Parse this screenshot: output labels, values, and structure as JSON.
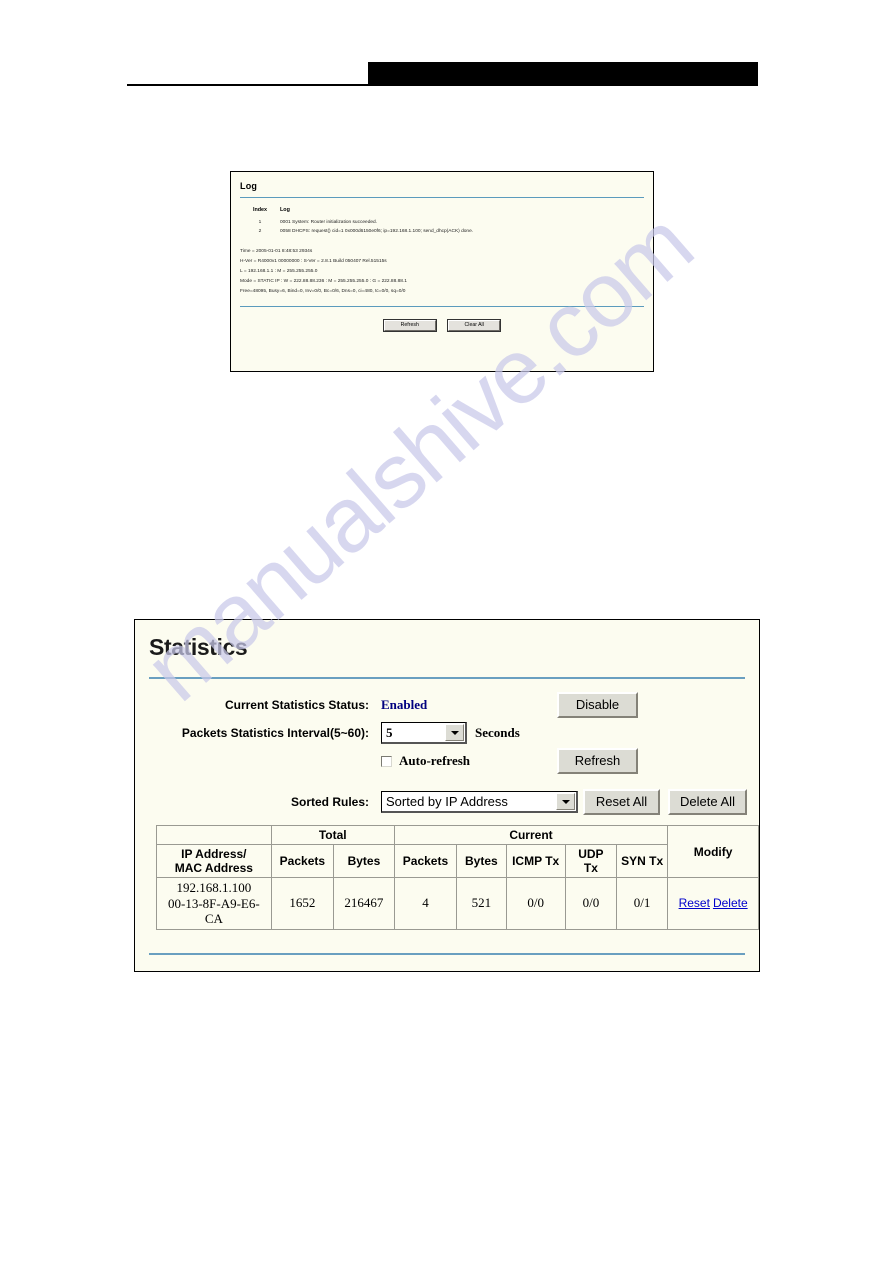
{
  "page": {
    "watermark": "manualshive.com",
    "header_redaction": ""
  },
  "log_panel": {
    "title": "Log",
    "columns": {
      "index": "Index",
      "log": "Log"
    },
    "entries": [
      {
        "index": "1",
        "message": "0001 System: Router initialization succeeded."
      },
      {
        "index": "2",
        "message": "0058 DHCPS: request() cid=1 0x000d6150e0f6; ip=192.168.1.100; send_dhcp(ACK) done."
      }
    ],
    "details": [
      "Time = 2005-01-01 8:48:53 2934s",
      "H-Ver = R4000v1 00000000 : S-Ver = 2.8.1 Build 050407 Rel.51515s",
      "L = 192.168.1.1 : M = 255.255.255.0",
      "Mode = STATIC IP : W = 222.88.88.236 : M = 255.255.255.0 : G = 222.88.88.1",
      "Free=48095, Busy=6, Bind=0, Inv=0/0, Bc=0/6, Dns=0, ci=480, tc=0/0, sq=0/0"
    ],
    "buttons": {
      "refresh": "Refresh",
      "clear_all": "Clear All"
    }
  },
  "statistics_panel": {
    "title": "Statistics",
    "fields": {
      "status_label": "Current Statistics Status:",
      "status_value": "Enabled",
      "status_button": "Disable",
      "interval_label": "Packets Statistics Interval(5~60):",
      "interval_value": "5",
      "interval_unit": "Seconds",
      "autorefresh_label": "Auto-refresh",
      "autorefresh_checked": false,
      "refresh_button": "Refresh",
      "sorted_label": "Sorted Rules:",
      "sorted_value": "Sorted by IP Address",
      "reset_all_button": "Reset All",
      "delete_all_button": "Delete All"
    },
    "table": {
      "group_headers": {
        "blank": "",
        "total": "Total",
        "current": "Current",
        "modify": "Modify"
      },
      "columns": [
        "IP Address/",
        "MAC Address",
        "Packets",
        "Bytes",
        "Packets",
        "Bytes",
        "ICMP Tx",
        "UDP Tx",
        "SYN Tx"
      ],
      "rows": [
        {
          "ip": "192.168.1.100",
          "mac": "00-13-8F-A9-E6-CA",
          "total_packets": "1652",
          "total_bytes": "216467",
          "current_packets": "4",
          "current_bytes": "521",
          "icmp_tx": "0/0",
          "udp_tx": "0/0",
          "syn_tx": "0/1",
          "reset_link": "Reset",
          "delete_link": "Delete"
        }
      ]
    }
  },
  "colors": {
    "panel_bg": "#fcfcf0",
    "divider_blue": "#6a9fc0",
    "status_value": "#00007f",
    "link": "#0000cc",
    "watermark": "#c9c9ea"
  }
}
